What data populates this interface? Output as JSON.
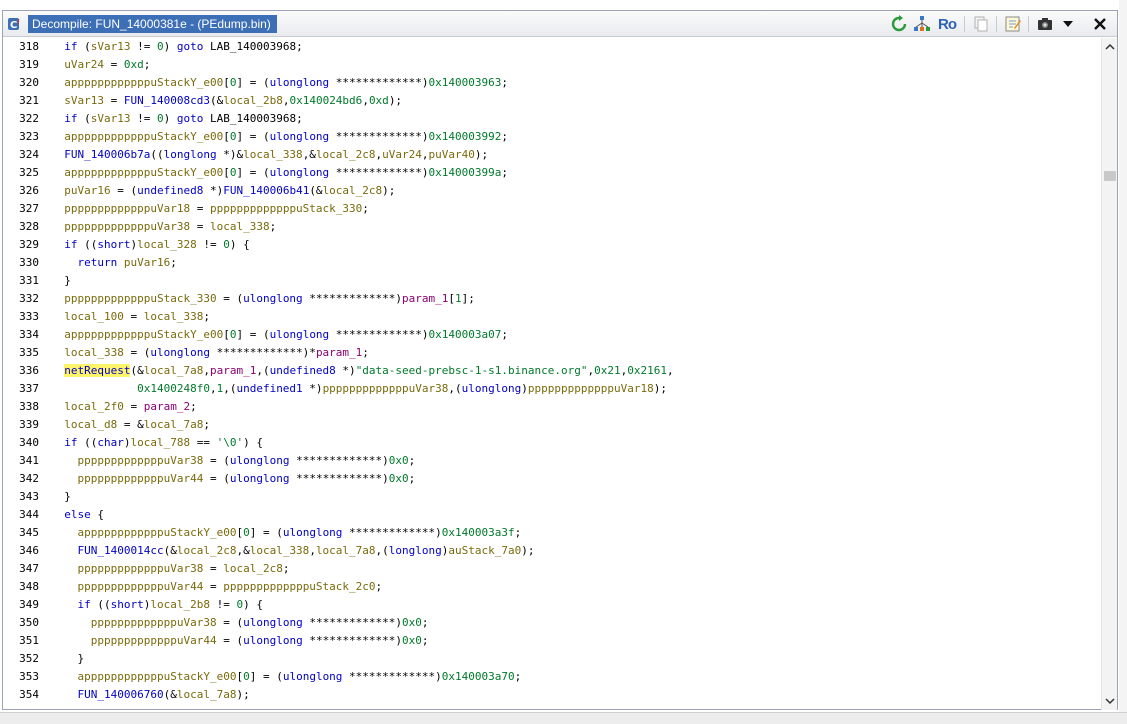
{
  "window": {
    "title": "Decompile: FUN_14000381e -  (PEdump.bin)",
    "toolbar": {
      "icons": [
        "refresh-icon",
        "graph-icon",
        "ro-toggle",
        "copy-icon",
        "edit-icon",
        "snapshot-icon",
        "menu-dropdown-icon",
        "close-icon"
      ],
      "ro_label": "Ro"
    }
  },
  "colors": {
    "title_bg": "#3d6fb6",
    "keyword": "#0000c8",
    "variable": "#7a6a0c",
    "number": "#007a2a",
    "parameter": "#8b0074",
    "highlight": "#fff46a"
  },
  "code_lines": [
    {
      "n": "318",
      "tokens": [
        [
          "  ",
          ""
        ],
        [
          "if",
          "kw"
        ],
        [
          " (",
          ""
        ],
        [
          "sVar13",
          "var"
        ],
        [
          " != ",
          ""
        ],
        [
          "0",
          "num"
        ],
        [
          ") ",
          ""
        ],
        [
          "goto",
          "kw"
        ],
        [
          " LAB_140003968;",
          "lbl"
        ]
      ]
    },
    {
      "n": "319",
      "tokens": [
        [
          "  ",
          ""
        ],
        [
          "uVar24",
          "var"
        ],
        [
          " = ",
          ""
        ],
        [
          "0xd",
          "num"
        ],
        [
          ";",
          ""
        ]
      ]
    },
    {
      "n": "320",
      "tokens": [
        [
          "  ",
          ""
        ],
        [
          "appppppppppppuStackY_e00",
          "var"
        ],
        [
          "[",
          ""
        ],
        [
          "0",
          "num"
        ],
        [
          "] = (",
          ""
        ],
        [
          "ulonglong",
          "ty"
        ],
        [
          " *************)",
          ""
        ],
        [
          "0x140003963",
          "num"
        ],
        [
          ";",
          ""
        ]
      ]
    },
    {
      "n": "321",
      "tokens": [
        [
          "  ",
          ""
        ],
        [
          "sVar13",
          "var"
        ],
        [
          " = ",
          ""
        ],
        [
          "FUN_140008cd3",
          "fn"
        ],
        [
          "(&",
          ""
        ],
        [
          "local_2b8",
          "var"
        ],
        [
          ",",
          ""
        ],
        [
          "0x140024bd6",
          "num"
        ],
        [
          ",",
          ""
        ],
        [
          "0xd",
          "num"
        ],
        [
          ");",
          ""
        ]
      ]
    },
    {
      "n": "322",
      "tokens": [
        [
          "  ",
          ""
        ],
        [
          "if",
          "kw"
        ],
        [
          " (",
          ""
        ],
        [
          "sVar13",
          "var"
        ],
        [
          " != ",
          ""
        ],
        [
          "0",
          "num"
        ],
        [
          ") ",
          ""
        ],
        [
          "goto",
          "kw"
        ],
        [
          " LAB_140003968;",
          "lbl"
        ]
      ]
    },
    {
      "n": "323",
      "tokens": [
        [
          "  ",
          ""
        ],
        [
          "appppppppppppuStackY_e00",
          "var"
        ],
        [
          "[",
          ""
        ],
        [
          "0",
          "num"
        ],
        [
          "] = (",
          ""
        ],
        [
          "ulonglong",
          "ty"
        ],
        [
          " *************)",
          ""
        ],
        [
          "0x140003992",
          "num"
        ],
        [
          ";",
          ""
        ]
      ]
    },
    {
      "n": "324",
      "tokens": [
        [
          "  ",
          ""
        ],
        [
          "FUN_140006b7a",
          "fn"
        ],
        [
          "((",
          ""
        ],
        [
          "longlong",
          "ty"
        ],
        [
          " *)&",
          ""
        ],
        [
          "local_338",
          "var"
        ],
        [
          ",&",
          ""
        ],
        [
          "local_2c8",
          "var"
        ],
        [
          ",",
          ""
        ],
        [
          "uVar24",
          "var"
        ],
        [
          ",",
          ""
        ],
        [
          "puVar40",
          "var"
        ],
        [
          ");",
          ""
        ]
      ]
    },
    {
      "n": "325",
      "tokens": [
        [
          "  ",
          ""
        ],
        [
          "appppppppppppuStackY_e00",
          "var"
        ],
        [
          "[",
          ""
        ],
        [
          "0",
          "num"
        ],
        [
          "] = (",
          ""
        ],
        [
          "ulonglong",
          "ty"
        ],
        [
          " *************)",
          ""
        ],
        [
          "0x14000399a",
          "num"
        ],
        [
          ";",
          ""
        ]
      ]
    },
    {
      "n": "326",
      "tokens": [
        [
          "  ",
          ""
        ],
        [
          "puVar16",
          "var"
        ],
        [
          " = (",
          ""
        ],
        [
          "undefined8",
          "ty"
        ],
        [
          " *)",
          ""
        ],
        [
          "FUN_140006b41",
          "fn"
        ],
        [
          "(&",
          ""
        ],
        [
          "local_2c8",
          "var"
        ],
        [
          ");",
          ""
        ]
      ]
    },
    {
      "n": "327",
      "tokens": [
        [
          "  ",
          ""
        ],
        [
          "pppppppppppppuVar18",
          "var"
        ],
        [
          " = ",
          ""
        ],
        [
          "pppppppppppppuStack_330",
          "var"
        ],
        [
          ";",
          ""
        ]
      ]
    },
    {
      "n": "328",
      "tokens": [
        [
          "  ",
          ""
        ],
        [
          "pppppppppppppuVar38",
          "var"
        ],
        [
          " = ",
          ""
        ],
        [
          "local_338",
          "var"
        ],
        [
          ";",
          ""
        ]
      ]
    },
    {
      "n": "329",
      "tokens": [
        [
          "  ",
          ""
        ],
        [
          "if",
          "kw"
        ],
        [
          " ((",
          ""
        ],
        [
          "short",
          "ty"
        ],
        [
          ")",
          ""
        ],
        [
          "local_328",
          "var"
        ],
        [
          " != ",
          ""
        ],
        [
          "0",
          "num"
        ],
        [
          ") {",
          ""
        ]
      ]
    },
    {
      "n": "330",
      "tokens": [
        [
          "    ",
          ""
        ],
        [
          "return",
          "kw"
        ],
        [
          " ",
          ""
        ],
        [
          "puVar16",
          "var"
        ],
        [
          ";",
          ""
        ]
      ]
    },
    {
      "n": "331",
      "tokens": [
        [
          "  }",
          ""
        ]
      ]
    },
    {
      "n": "332",
      "tokens": [
        [
          "  ",
          ""
        ],
        [
          "pppppppppppppuStack_330",
          "var"
        ],
        [
          " = (",
          ""
        ],
        [
          "ulonglong",
          "ty"
        ],
        [
          " *************)",
          ""
        ],
        [
          "param_1",
          "par"
        ],
        [
          "[",
          ""
        ],
        [
          "1",
          "num"
        ],
        [
          "];",
          ""
        ]
      ]
    },
    {
      "n": "333",
      "tokens": [
        [
          "  ",
          ""
        ],
        [
          "local_100",
          "var"
        ],
        [
          " = ",
          ""
        ],
        [
          "local_338",
          "var"
        ],
        [
          ";",
          ""
        ]
      ]
    },
    {
      "n": "334",
      "tokens": [
        [
          "  ",
          ""
        ],
        [
          "appppppppppppuStackY_e00",
          "var"
        ],
        [
          "[",
          ""
        ],
        [
          "0",
          "num"
        ],
        [
          "] = (",
          ""
        ],
        [
          "ulonglong",
          "ty"
        ],
        [
          " *************)",
          ""
        ],
        [
          "0x140003a07",
          "num"
        ],
        [
          ";",
          ""
        ]
      ]
    },
    {
      "n": "335",
      "tokens": [
        [
          "  ",
          ""
        ],
        [
          "local_338",
          "var"
        ],
        [
          " = (",
          ""
        ],
        [
          "ulonglong",
          "ty"
        ],
        [
          " *************)*",
          ""
        ],
        [
          "param_1",
          "par"
        ],
        [
          ";",
          ""
        ]
      ]
    },
    {
      "n": "336",
      "tokens": [
        [
          "  ",
          ""
        ],
        [
          "netRequest",
          "hl"
        ],
        [
          "(&",
          ""
        ],
        [
          "local_7a8",
          "var"
        ],
        [
          ",",
          ""
        ],
        [
          "param_1",
          "par"
        ],
        [
          ",(",
          ""
        ],
        [
          "undefined8",
          "ty"
        ],
        [
          " *)",
          ""
        ],
        [
          "\"data-seed-prebsc-1-s1.binance.org\"",
          "str"
        ],
        [
          ",",
          ""
        ],
        [
          "0x21",
          "num"
        ],
        [
          ",",
          ""
        ],
        [
          "0x2161",
          "num"
        ],
        [
          ",",
          ""
        ]
      ]
    },
    {
      "n": "337",
      "tokens": [
        [
          "             ",
          ""
        ],
        [
          "0x1400248f0",
          "num"
        ],
        [
          ",",
          ""
        ],
        [
          "1",
          "num"
        ],
        [
          ",(",
          ""
        ],
        [
          "undefined1",
          "ty"
        ],
        [
          " *)",
          ""
        ],
        [
          "pppppppppppppuVar38",
          "var"
        ],
        [
          ",(",
          ""
        ],
        [
          "ulonglong",
          "ty"
        ],
        [
          ")",
          ""
        ],
        [
          "pppppppppppppuVar18",
          "var"
        ],
        [
          ");",
          ""
        ]
      ]
    },
    {
      "n": "338",
      "tokens": [
        [
          "  ",
          ""
        ],
        [
          "local_2f0",
          "var"
        ],
        [
          " = ",
          ""
        ],
        [
          "param_2",
          "par"
        ],
        [
          ";",
          ""
        ]
      ]
    },
    {
      "n": "339",
      "tokens": [
        [
          "  ",
          ""
        ],
        [
          "local_d8",
          "var"
        ],
        [
          " = &",
          ""
        ],
        [
          "local_7a8",
          "var"
        ],
        [
          ";",
          ""
        ]
      ]
    },
    {
      "n": "340",
      "tokens": [
        [
          "  ",
          ""
        ],
        [
          "if",
          "kw"
        ],
        [
          " ((",
          ""
        ],
        [
          "char",
          "ty"
        ],
        [
          ")",
          ""
        ],
        [
          "local_788",
          "var"
        ],
        [
          " == ",
          ""
        ],
        [
          "'\\0'",
          "num"
        ],
        [
          ") {",
          ""
        ]
      ]
    },
    {
      "n": "341",
      "tokens": [
        [
          "    ",
          ""
        ],
        [
          "pppppppppppppuVar38",
          "var"
        ],
        [
          " = (",
          ""
        ],
        [
          "ulonglong",
          "ty"
        ],
        [
          " *************)",
          ""
        ],
        [
          "0x0",
          "num"
        ],
        [
          ";",
          ""
        ]
      ]
    },
    {
      "n": "342",
      "tokens": [
        [
          "    ",
          ""
        ],
        [
          "pppppppppppppuVar44",
          "var"
        ],
        [
          " = (",
          ""
        ],
        [
          "ulonglong",
          "ty"
        ],
        [
          " *************)",
          ""
        ],
        [
          "0x0",
          "num"
        ],
        [
          ";",
          ""
        ]
      ]
    },
    {
      "n": "343",
      "tokens": [
        [
          "  }",
          ""
        ]
      ]
    },
    {
      "n": "344",
      "tokens": [
        [
          "  ",
          ""
        ],
        [
          "else",
          "kw"
        ],
        [
          " {",
          ""
        ]
      ]
    },
    {
      "n": "345",
      "tokens": [
        [
          "    ",
          ""
        ],
        [
          "appppppppppppuStackY_e00",
          "var"
        ],
        [
          "[",
          ""
        ],
        [
          "0",
          "num"
        ],
        [
          "] = (",
          ""
        ],
        [
          "ulonglong",
          "ty"
        ],
        [
          " *************)",
          ""
        ],
        [
          "0x140003a3f",
          "num"
        ],
        [
          ";",
          ""
        ]
      ]
    },
    {
      "n": "346",
      "tokens": [
        [
          "    ",
          ""
        ],
        [
          "FUN_1400014cc",
          "fn"
        ],
        [
          "(&",
          ""
        ],
        [
          "local_2c8",
          "var"
        ],
        [
          ",&",
          ""
        ],
        [
          "local_338",
          "var"
        ],
        [
          ",",
          ""
        ],
        [
          "local_7a8",
          "var"
        ],
        [
          ",(",
          ""
        ],
        [
          "longlong",
          "ty"
        ],
        [
          ")",
          ""
        ],
        [
          "auStack_7a0",
          "var"
        ],
        [
          ");",
          ""
        ]
      ]
    },
    {
      "n": "347",
      "tokens": [
        [
          "    ",
          ""
        ],
        [
          "pppppppppppppuVar38",
          "var"
        ],
        [
          " = ",
          ""
        ],
        [
          "local_2c8",
          "var"
        ],
        [
          ";",
          ""
        ]
      ]
    },
    {
      "n": "348",
      "tokens": [
        [
          "    ",
          ""
        ],
        [
          "pppppppppppppuVar44",
          "var"
        ],
        [
          " = ",
          ""
        ],
        [
          "pppppppppppppuStack_2c0",
          "var"
        ],
        [
          ";",
          ""
        ]
      ]
    },
    {
      "n": "349",
      "tokens": [
        [
          "    ",
          ""
        ],
        [
          "if",
          "kw"
        ],
        [
          " ((",
          ""
        ],
        [
          "short",
          "ty"
        ],
        [
          ")",
          ""
        ],
        [
          "local_2b8",
          "var"
        ],
        [
          " != ",
          ""
        ],
        [
          "0",
          "num"
        ],
        [
          ") {",
          ""
        ]
      ]
    },
    {
      "n": "350",
      "tokens": [
        [
          "      ",
          ""
        ],
        [
          "pppppppppppppuVar38",
          "var"
        ],
        [
          " = (",
          ""
        ],
        [
          "ulonglong",
          "ty"
        ],
        [
          " *************)",
          ""
        ],
        [
          "0x0",
          "num"
        ],
        [
          ";",
          ""
        ]
      ]
    },
    {
      "n": "351",
      "tokens": [
        [
          "      ",
          ""
        ],
        [
          "pppppppppppppuVar44",
          "var"
        ],
        [
          " = (",
          ""
        ],
        [
          "ulonglong",
          "ty"
        ],
        [
          " *************)",
          ""
        ],
        [
          "0x0",
          "num"
        ],
        [
          ";",
          ""
        ]
      ]
    },
    {
      "n": "352",
      "tokens": [
        [
          "    }",
          ""
        ]
      ]
    },
    {
      "n": "353",
      "tokens": [
        [
          "    ",
          ""
        ],
        [
          "appppppppppppuStackY_e00",
          "var"
        ],
        [
          "[",
          ""
        ],
        [
          "0",
          "num"
        ],
        [
          "] = (",
          ""
        ],
        [
          "ulonglong",
          "ty"
        ],
        [
          " *************)",
          ""
        ],
        [
          "0x140003a70",
          "num"
        ],
        [
          ";",
          ""
        ]
      ]
    },
    {
      "n": "354",
      "tokens": [
        [
          "    ",
          ""
        ],
        [
          "FUN_140006760",
          "fn"
        ],
        [
          "(&",
          ""
        ],
        [
          "local_7a8",
          "var"
        ],
        [
          ");",
          ""
        ]
      ]
    }
  ]
}
